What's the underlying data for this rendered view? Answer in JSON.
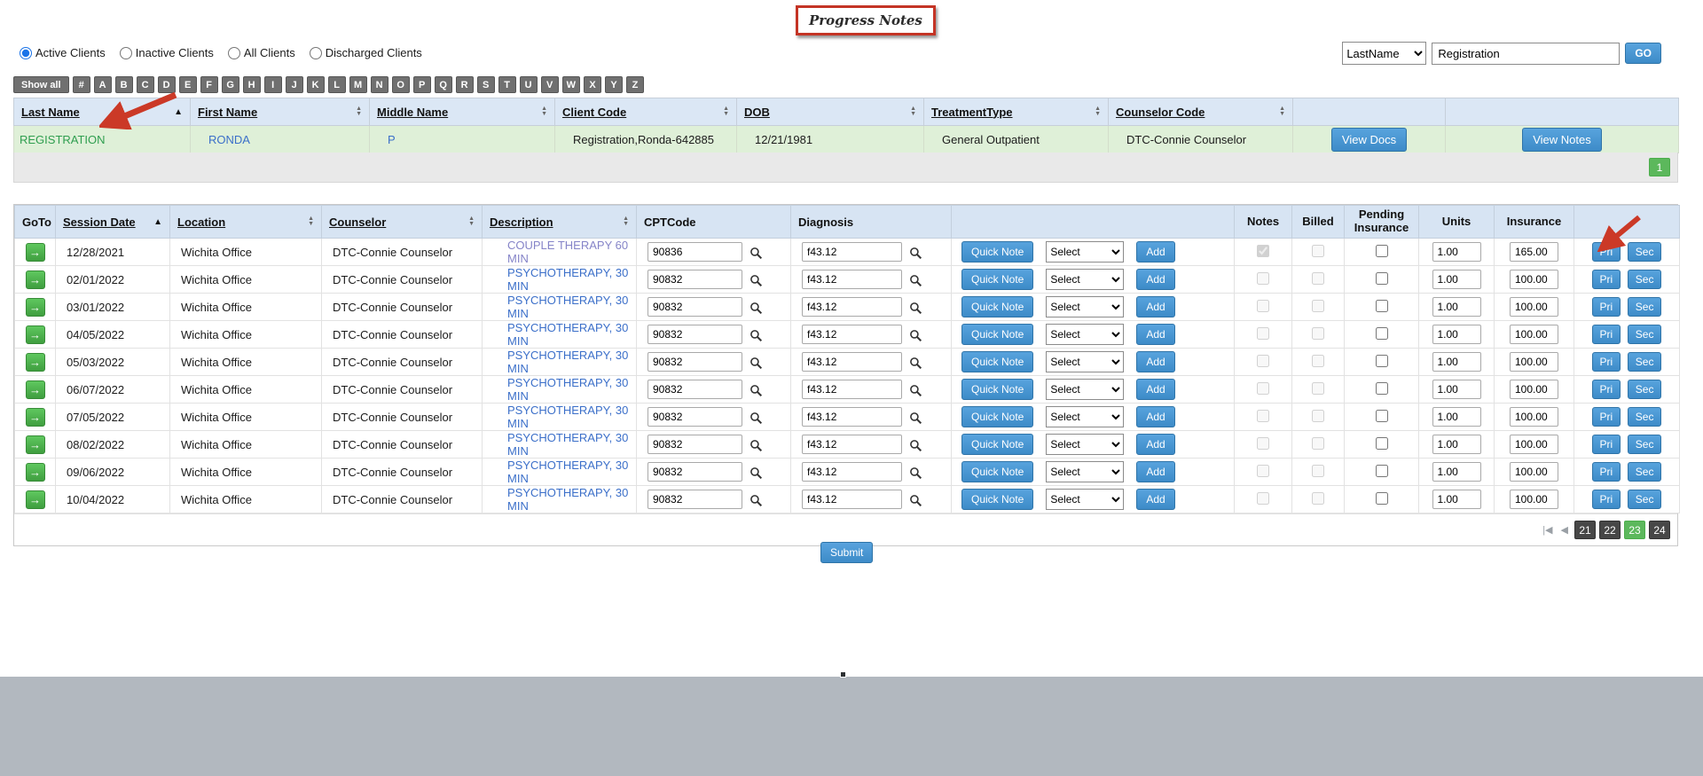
{
  "page": {
    "title": "Progress Notes",
    "submit_label": "Submit"
  },
  "filters": {
    "options": [
      {
        "label": "Active Clients",
        "selected": true
      },
      {
        "label": "Inactive Clients",
        "selected": false
      },
      {
        "label": "All Clients",
        "selected": false
      },
      {
        "label": "Discharged Clients",
        "selected": false
      }
    ]
  },
  "search": {
    "field_selected": "LastName",
    "query": "Registration",
    "go_label": "GO"
  },
  "alphabet": {
    "show_all": "Show all",
    "letters": [
      "#",
      "A",
      "B",
      "C",
      "D",
      "E",
      "F",
      "G",
      "H",
      "I",
      "J",
      "K",
      "L",
      "M",
      "N",
      "O",
      "P",
      "Q",
      "R",
      "S",
      "T",
      "U",
      "V",
      "W",
      "X",
      "Y",
      "Z"
    ]
  },
  "clients": {
    "headers": [
      "Last Name",
      "First Name",
      "Middle Name",
      "Client Code",
      "DOB",
      "TreatmentType",
      "Counselor Code"
    ],
    "row": {
      "last_name": "REGISTRATION",
      "first_name": "RONDA",
      "middle_name": "P",
      "client_code": "Registration,Ronda-642885",
      "dob": "12/21/1981",
      "treatment_type": "General Outpatient",
      "counselor_code": "DTC-Connie Counselor",
      "view_docs_label": "View Docs",
      "view_notes_label": "View Notes"
    },
    "pagination": {
      "pages": [
        "1"
      ],
      "active": "1"
    }
  },
  "sessions": {
    "headers": [
      {
        "label": "GoTo",
        "sort": null,
        "center": false
      },
      {
        "label": "Session Date",
        "sort": "asc",
        "center": false
      },
      {
        "label": "Location",
        "sort": "both",
        "center": false
      },
      {
        "label": "Counselor",
        "sort": "both",
        "center": false
      },
      {
        "label": "Description",
        "sort": "both",
        "center": false
      },
      {
        "label": "CPTCode",
        "sort": null,
        "center": false
      },
      {
        "label": "Diagnosis",
        "sort": null,
        "center": false
      },
      {
        "label": "",
        "sort": null,
        "center": false
      },
      {
        "label": "Notes",
        "sort": null,
        "center": true
      },
      {
        "label": "Billed",
        "sort": null,
        "center": true
      },
      {
        "label": "Pending Insurance",
        "sort": null,
        "center": true
      },
      {
        "label": "Units",
        "sort": null,
        "center": true
      },
      {
        "label": "Insurance",
        "sort": null,
        "center": true
      },
      {
        "label": "",
        "sort": null,
        "center": false
      }
    ],
    "labels": {
      "quick_note": "Quick Note",
      "select": "Select",
      "add": "Add",
      "pri": "Pri",
      "sec": "Sec"
    },
    "rows": [
      {
        "date": "12/28/2021",
        "location": "Wichita Office",
        "counselor": "DTC-Connie Counselor",
        "description": "COUPLE THERAPY 60 MIN",
        "cpt": "90836",
        "diagnosis": "f43.12",
        "units": "1.00",
        "insurance": "165.00",
        "notes_checked": true,
        "visited": true
      },
      {
        "date": "02/01/2022",
        "location": "Wichita Office",
        "counselor": "DTC-Connie Counselor",
        "description": "PSYCHOTHERAPY, 30 MIN",
        "cpt": "90832",
        "diagnosis": "f43.12",
        "units": "1.00",
        "insurance": "100.00",
        "notes_checked": false,
        "visited": false
      },
      {
        "date": "03/01/2022",
        "location": "Wichita Office",
        "counselor": "DTC-Connie Counselor",
        "description": "PSYCHOTHERAPY, 30 MIN",
        "cpt": "90832",
        "diagnosis": "f43.12",
        "units": "1.00",
        "insurance": "100.00",
        "notes_checked": false,
        "visited": false
      },
      {
        "date": "04/05/2022",
        "location": "Wichita Office",
        "counselor": "DTC-Connie Counselor",
        "description": "PSYCHOTHERAPY, 30 MIN",
        "cpt": "90832",
        "diagnosis": "f43.12",
        "units": "1.00",
        "insurance": "100.00",
        "notes_checked": false,
        "visited": false
      },
      {
        "date": "05/03/2022",
        "location": "Wichita Office",
        "counselor": "DTC-Connie Counselor",
        "description": "PSYCHOTHERAPY, 30 MIN",
        "cpt": "90832",
        "diagnosis": "f43.12",
        "units": "1.00",
        "insurance": "100.00",
        "notes_checked": false,
        "visited": false
      },
      {
        "date": "06/07/2022",
        "location": "Wichita Office",
        "counselor": "DTC-Connie Counselor",
        "description": "PSYCHOTHERAPY, 30 MIN",
        "cpt": "90832",
        "diagnosis": "f43.12",
        "units": "1.00",
        "insurance": "100.00",
        "notes_checked": false,
        "visited": false
      },
      {
        "date": "07/05/2022",
        "location": "Wichita Office",
        "counselor": "DTC-Connie Counselor",
        "description": "PSYCHOTHERAPY, 30 MIN",
        "cpt": "90832",
        "diagnosis": "f43.12",
        "units": "1.00",
        "insurance": "100.00",
        "notes_checked": false,
        "visited": false
      },
      {
        "date": "08/02/2022",
        "location": "Wichita Office",
        "counselor": "DTC-Connie Counselor",
        "description": "PSYCHOTHERAPY, 30 MIN",
        "cpt": "90832",
        "diagnosis": "f43.12",
        "units": "1.00",
        "insurance": "100.00",
        "notes_checked": false,
        "visited": false
      },
      {
        "date": "09/06/2022",
        "location": "Wichita Office",
        "counselor": "DTC-Connie Counselor",
        "description": "PSYCHOTHERAPY, 30 MIN",
        "cpt": "90832",
        "diagnosis": "f43.12",
        "units": "1.00",
        "insurance": "100.00",
        "notes_checked": false,
        "visited": false
      },
      {
        "date": "10/04/2022",
        "location": "Wichita Office",
        "counselor": "DTC-Connie Counselor",
        "description": "PSYCHOTHERAPY, 30 MIN",
        "cpt": "90832",
        "diagnosis": "f43.12",
        "units": "1.00",
        "insurance": "100.00",
        "notes_checked": false,
        "visited": false
      }
    ],
    "pagination": {
      "first_icon": "|◀",
      "prev_icon": "◀",
      "pages": [
        "21",
        "22",
        "23",
        "24"
      ],
      "active": "23"
    }
  },
  "colors": {
    "accent_blue": "#4190cf",
    "success_green": "#5cb85c",
    "row_highlight_green": "#dff0d8",
    "table_header_blue": "#d7e4f3",
    "annotation_red": "#c43425",
    "alphabet_gray": "#707070"
  }
}
